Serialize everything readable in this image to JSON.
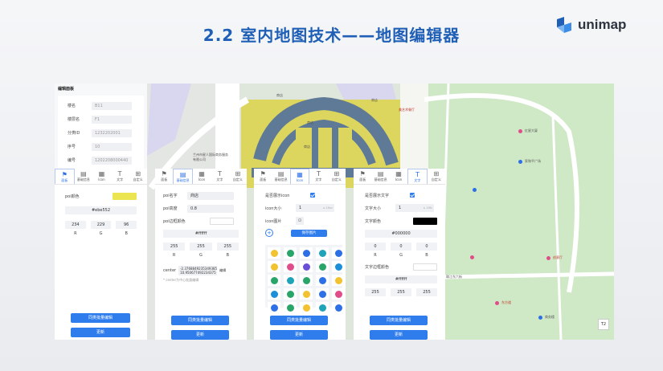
{
  "slide_title": "2.2 室内地图技术——地图编辑器",
  "logo_text": "unimap",
  "edit_panel": {
    "title": "编辑面板",
    "fields": [
      {
        "label": "楼名",
        "value": "B11"
      },
      {
        "label": "楼层名",
        "value": "F1"
      },
      {
        "label": "分类ID",
        "value": "1232202001"
      },
      {
        "label": "序号",
        "value": "10"
      },
      {
        "label": "编号",
        "value": "1202208000440"
      }
    ]
  },
  "tabs": [
    {
      "icon": "⚑",
      "label": "面板"
    },
    {
      "icon": "▤",
      "label": "基础信息"
    },
    {
      "icon": "▦",
      "label": "Icon"
    },
    {
      "icon": "T",
      "label": "文字"
    },
    {
      "icon": "⊞",
      "label": "自定义"
    }
  ],
  "panel1": {
    "poi_color_label": "poi颜色",
    "poi_color": "#ebe552",
    "hex": "#ebe552",
    "rgb": [
      "234",
      "229",
      "96"
    ],
    "rgb_labels": [
      "R",
      "G",
      "B"
    ],
    "batch_button": "同类批量编辑",
    "update_button": "更新"
  },
  "panel2": {
    "name_label": "poi名字",
    "name_value": "商店",
    "height_label": "poi高度",
    "height_value": "0.8",
    "border_label": "poi边框颜色",
    "hex": "#ffffff",
    "rgb": [
      "255",
      "255",
      "255"
    ],
    "rgb_labels": [
      "R",
      "G",
      "B"
    ],
    "center_label": "center",
    "center_value": "-2.3768849235349385 10.950677492234375",
    "center_button": "编辑",
    "center_hint": "* center为中心批量编辑",
    "batch_button": "同类批量编辑",
    "update_button": "更新"
  },
  "panel3": {
    "show_icon_label": "是否展示icon",
    "icon_size_label": "icon大小",
    "icon_size_value": "1",
    "icon_size_unit": "≤ 1fixc",
    "icon_image_label": "icon图片",
    "save_button": "保存图片",
    "batch_button": "同类批量编辑",
    "update_button": "更新",
    "icon_colors": [
      "#f2c230",
      "#2aa56a",
      "#2d6fe6",
      "#1fa3b8",
      "#2d6fe6",
      "#f2c230",
      "#e14d8a",
      "#6b4fd8",
      "#2aa56a",
      "#1d8fd8",
      "#2aa56a",
      "#1fa3b8",
      "#2aa56a",
      "#2d6fe6",
      "#f2c230",
      "#1d8fd8",
      "#2aa56a",
      "#f2c230",
      "#2d6fe6",
      "#e14d8a",
      "#2d6fe6",
      "#2aa56a",
      "#f2c230",
      "#1fa3b8",
      "#2d6fe6"
    ]
  },
  "panel4": {
    "show_text_label": "是否展示文字",
    "text_size_label": "文字大小",
    "text_size_value": "1",
    "text_size_unit": "≤ 1fifc",
    "text_color_label": "文字颜色",
    "text_color": "#000000",
    "hex": "#000000",
    "rgb": [
      "0",
      "0",
      "0"
    ],
    "rgb_labels": [
      "R",
      "G",
      "B"
    ],
    "border_label": "文字边框颜色",
    "border_hex": "#ffffff",
    "border_rgb": [
      "255",
      "255",
      "255"
    ],
    "batch_button": "同类批量编辑",
    "update_button": "更新"
  },
  "map_labels": {
    "l1": "商店",
    "l2": "商店",
    "l3": "商店",
    "l4": "商店",
    "l5": "兰州市星人国际商务服务有限公司",
    "l6": "美艺术餐厅",
    "l7": "红星大厦",
    "l8": "家和平广场",
    "l9": "创意厅",
    "l10": "珠江东六街",
    "l11": "东方道",
    "l12": "商务楼"
  },
  "zoom_label": "T2"
}
